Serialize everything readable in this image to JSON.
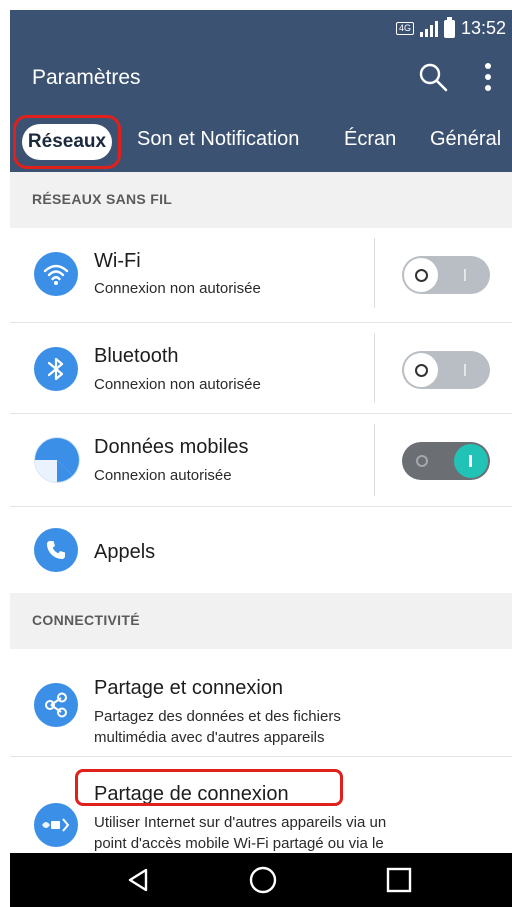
{
  "status_bar": {
    "network_badge": "4G",
    "time": "13:52",
    "icons": [
      "lte-icon",
      "signal-icon",
      "battery-icon"
    ]
  },
  "toolbar": {
    "title": "Paramètres",
    "icons": [
      "search-icon",
      "more-vert-icon"
    ]
  },
  "tabs": [
    {
      "label": "Réseaux",
      "selected": true
    },
    {
      "label": "Son et Notification"
    },
    {
      "label": "Écran"
    },
    {
      "label": "Général"
    }
  ],
  "sections": {
    "wireless": "RÉSEAUX SANS FIL",
    "connectivity": "CONNECTIVITÉ"
  },
  "items": {
    "wifi": {
      "title": "Wi-Fi",
      "subtitle": "Connexion non autorisée",
      "toggle_on": false,
      "icon": "wifi-icon"
    },
    "bluetooth": {
      "title": "Bluetooth",
      "subtitle": "Connexion non autorisée",
      "toggle_on": false,
      "icon": "bluetooth-icon"
    },
    "mobile_data": {
      "title": "Données mobiles",
      "subtitle": "Connexion autorisée",
      "toggle_on": true,
      "icon": "mobile-data-icon"
    },
    "calls": {
      "title": "Appels",
      "icon": "phone-icon"
    },
    "share_connect": {
      "title": "Partage et connexion",
      "subtitle_line1": "Partagez des données et des fichiers",
      "subtitle_line2": "multimédia avec d'autres appareils",
      "icon": "share-icon"
    },
    "tethering": {
      "title": "Partage de connexion",
      "subtitle_line1": "Utiliser Internet sur d'autres appareils via un",
      "subtitle_line2": "point d'accès mobile Wi-Fi partagé ou via le",
      "icon": "hotspot-icon"
    }
  },
  "colors": {
    "header": "#3c5273",
    "accent": "#3b8fe6",
    "toggle_on": "#21c3b6",
    "highlight": "#e0201b"
  },
  "nav_bar": {
    "icons": [
      "back-icon",
      "home-icon",
      "recents-icon"
    ]
  }
}
